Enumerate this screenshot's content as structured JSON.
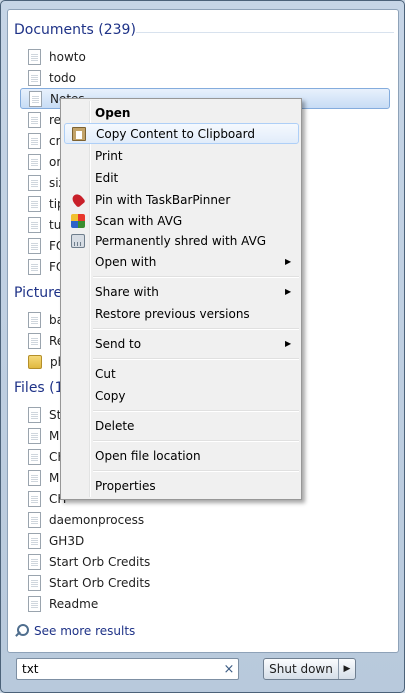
{
  "sections": {
    "documents": {
      "header": "Documents (239)",
      "items": [
        "howto",
        "todo",
        "Notes",
        "rea",
        "cra",
        "ora",
        "size",
        "tips",
        "tur",
        "FO",
        "FO"
      ]
    },
    "pictures": {
      "header": "Pictures",
      "items": [
        "bac",
        "Rea",
        "pho"
      ]
    },
    "files": {
      "header": "Files (1",
      "items": [
        "Star",
        "Mu",
        "CH",
        "Mu",
        "CH",
        "daemonprocess",
        "GH3D",
        "Start Orb Credits",
        "Start Orb Credits",
        "Readme"
      ]
    }
  },
  "see_more": "See more results",
  "search": {
    "value": "txt",
    "clear_glyph": "×"
  },
  "shutdown": {
    "label": "Shut down",
    "arrow_glyph": "▶"
  },
  "context_menu": {
    "items": [
      {
        "label": "Open",
        "icon": ""
      },
      {
        "label": "Copy Content to Clipboard",
        "icon": "clipboard-icon"
      },
      {
        "label": "Print",
        "icon": ""
      },
      {
        "label": "Edit",
        "icon": ""
      },
      {
        "label": "Pin with TaskBarPinner",
        "icon": "pin-icon"
      },
      {
        "label": "Scan with AVG",
        "icon": "avg-icon"
      },
      {
        "label": "Permanently shred with AVG",
        "icon": "shredder-icon"
      },
      {
        "label": "Open with",
        "icon": ""
      },
      {
        "label": "Share with",
        "icon": ""
      },
      {
        "label": "Restore previous versions",
        "icon": ""
      },
      {
        "label": "Send to",
        "icon": ""
      },
      {
        "label": "Cut",
        "icon": ""
      },
      {
        "label": "Copy",
        "icon": ""
      },
      {
        "label": "Delete",
        "icon": ""
      },
      {
        "label": "Open file location",
        "icon": ""
      },
      {
        "label": "Properties",
        "icon": ""
      }
    ],
    "submenu_glyph": "▶"
  }
}
